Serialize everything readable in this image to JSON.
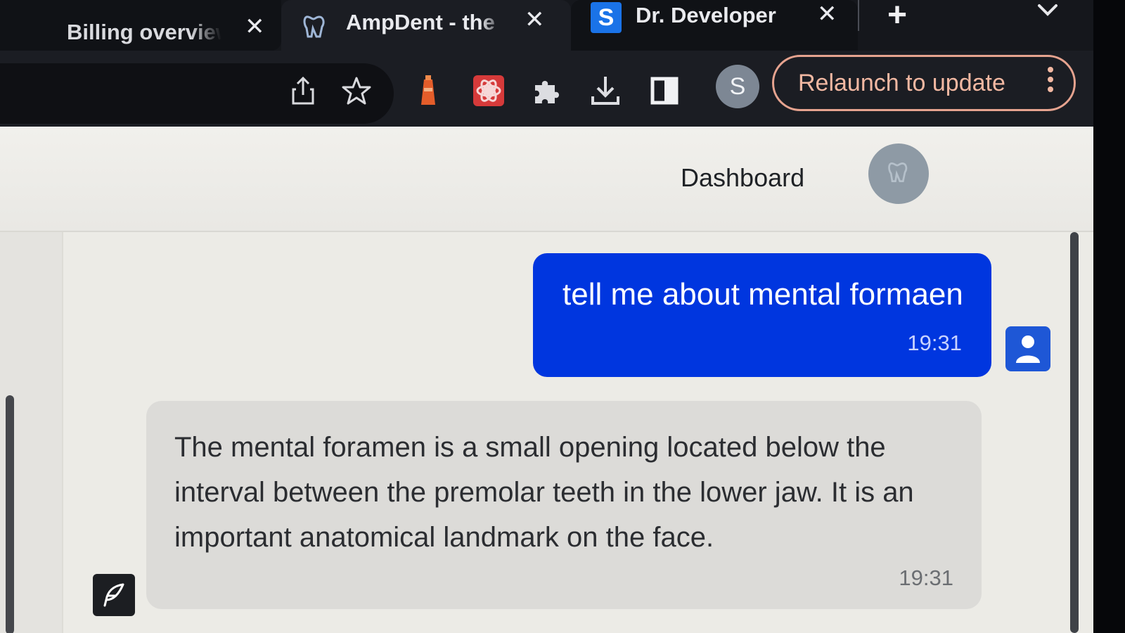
{
  "browser": {
    "tabs": [
      {
        "title": "Billing overview",
        "favicon": "none",
        "active": false
      },
      {
        "title": "AmpDent - the",
        "favicon": "tooth-icon",
        "active": true
      },
      {
        "title": "Dr. Developer",
        "favicon": "s-letter-icon",
        "favicon_letter": "S",
        "active": false
      }
    ],
    "new_tab_symbol": "+",
    "profile_initial": "S",
    "relaunch_label": "Relaunch to update",
    "toolbar_icons": [
      "share-icon",
      "bookmark-star-icon",
      "extension-lighthouse-icon",
      "extension-red-icon",
      "extensions-puzzle-icon",
      "download-icon",
      "side-panel-icon"
    ]
  },
  "app": {
    "nav": {
      "dashboard_label": "Dashboard"
    },
    "messages": [
      {
        "role": "user",
        "text": "tell me about mental formaen",
        "time": "19:31"
      },
      {
        "role": "assistant",
        "text": "The mental foramen is a small opening located below the interval between the premolar teeth in the lower jaw. It is an important anatomical landmark on the face.",
        "time": "19:31"
      }
    ]
  },
  "colors": {
    "user_bubble": "#0036df",
    "assistant_bubble": "#dcdbd8",
    "relaunch_accent": "#f2b8a2",
    "browser_chrome": "#1b1d23"
  }
}
